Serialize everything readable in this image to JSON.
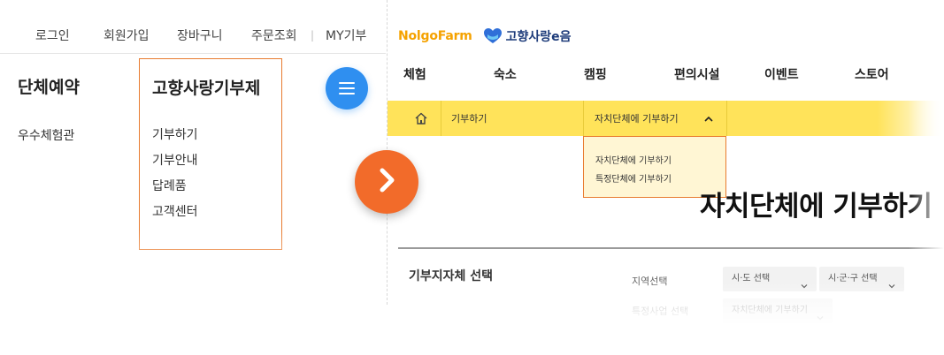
{
  "left": {
    "util_links": [
      "로그인",
      "회원가입",
      "장바구니",
      "주문조회",
      "MY기부"
    ],
    "util_separator": "|",
    "category_title": "단체예약",
    "category_sub": "우수체험관",
    "box": {
      "title": "고향사랑기부제",
      "items": [
        "기부하기",
        "기부안내",
        "답례품",
        "고객센터"
      ]
    },
    "menu_icon": "hamburger-menu-icon",
    "arrow_icon": "chevron-right-icon"
  },
  "right": {
    "logo_nolgo": "NolgoFarm",
    "logo_gohyang": "고향사랑e음",
    "nav": [
      "체험",
      "숙소",
      "캠핑",
      "편의시설",
      "이벤트",
      "스토어"
    ],
    "breadcrumb": {
      "home_icon": "home-icon",
      "first": "기부하기",
      "second": "자치단체에 기부하기"
    },
    "dropdown_options": [
      "자치단체에 기부하기",
      "특정단체에 기부하기"
    ],
    "page_title": "자치단체에 기부하기",
    "section_title": "기부지자체 선택",
    "region_label": "지역선택",
    "sido_select": "시·도 선택",
    "sigungu_select": "시·군·구 선택",
    "project_label": "특정사업 선택",
    "project_select": "자치단체에 기부하기"
  },
  "colors": {
    "accent_orange": "#e87b2f",
    "arrow_orange": "#f26b2a",
    "menu_blue": "#2f8ff0",
    "yellow_bar": "#ffe35a",
    "dropdown_bg": "#fff6d4"
  }
}
